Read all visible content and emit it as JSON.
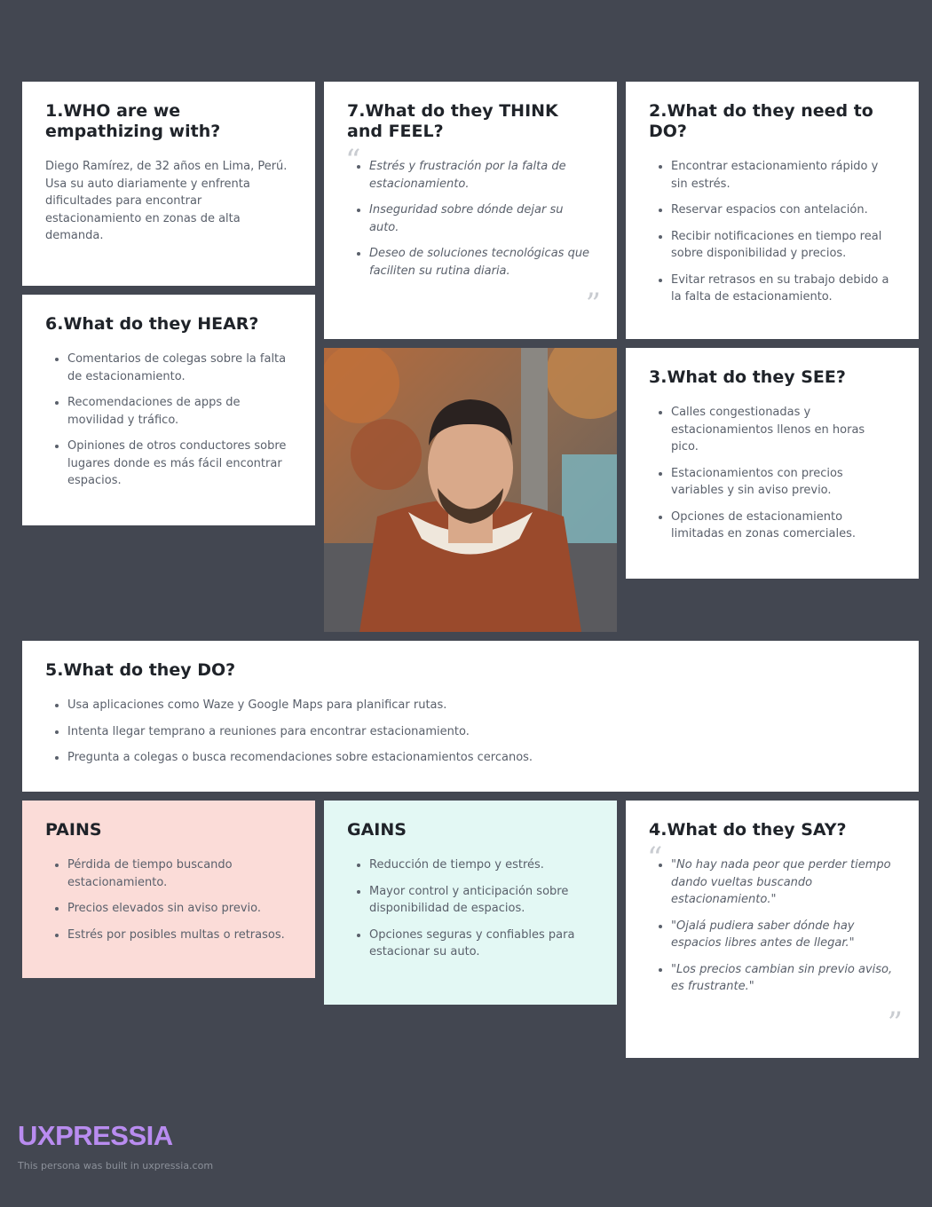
{
  "who": {
    "title": "1.WHO are we empathizing with?",
    "text": "Diego Ramírez, de 32 años en Lima, Perú. Usa su auto diariamente y enfrenta dificultades para encontrar estacionamiento en zonas de alta demanda."
  },
  "think_feel": {
    "title": "7.What do they THINK and FEEL?",
    "items": [
      "Estrés y frustración por la falta de estacionamiento.",
      "Inseguridad sobre dónde dejar su auto.",
      "Deseo de soluciones tecnológicas que faciliten su rutina diaria."
    ]
  },
  "need_to_do": {
    "title": "2.What do they need to DO?",
    "items": [
      "Encontrar estacionamiento rápido y sin estrés.",
      "Reservar espacios con antelación.",
      "Recibir notificaciones en tiempo real sobre disponibilidad y precios.",
      "Evitar retrasos en su trabajo debido a la falta de estacionamiento."
    ]
  },
  "hear": {
    "title": "6.What do they HEAR?",
    "items": [
      "Comentarios de colegas sobre la falta de estacionamiento.",
      "Recomendaciones de apps de movilidad y tráfico.",
      "Opiniones de otros conductores sobre lugares donde es más fácil encontrar espacios."
    ]
  },
  "see": {
    "title": "3.What do they SEE?",
    "items": [
      "Calles congestionadas y estacionamientos llenos en horas pico.",
      "Estacionamientos con precios variables y sin aviso previo.",
      "Opciones de estacionamiento limitadas en zonas comerciales."
    ]
  },
  "do": {
    "title": "5.What do they DO?",
    "items": [
      "Usa aplicaciones como Waze y Google Maps para planificar rutas.",
      "Intenta llegar temprano a reuniones para encontrar estacionamiento.",
      "Pregunta a colegas o busca recomendaciones sobre estacionamientos cercanos."
    ]
  },
  "pains": {
    "title": "PAINS",
    "items": [
      "Pérdida de tiempo buscando estacionamiento.",
      "Precios elevados sin aviso previo.",
      "Estrés por posibles multas o retrasos."
    ]
  },
  "gains": {
    "title": "GAINS",
    "items": [
      "Reducción de tiempo y estrés.",
      "Mayor control y anticipación sobre disponibilidad de espacios.",
      "Opciones seguras y confiables para estacionar su auto."
    ]
  },
  "say": {
    "title": "4.What do they SAY?",
    "items": [
      "\"No hay nada peor que perder tiempo dando vueltas buscando estacionamiento.\"",
      "\"Ojalá pudiera saber dónde hay espacios libres antes de llegar.\"",
      "\"Los precios cambian sin previo aviso, es frustrante.\""
    ]
  },
  "footer": {
    "brand": "UXPRESSIA",
    "built": "This persona was built in uxpressia.com"
  },
  "colors": {
    "background": "#434751",
    "card": "#ffffff",
    "pains": "#fbdcd8",
    "gains": "#e3f8f4",
    "brand": "#b98cf0"
  }
}
